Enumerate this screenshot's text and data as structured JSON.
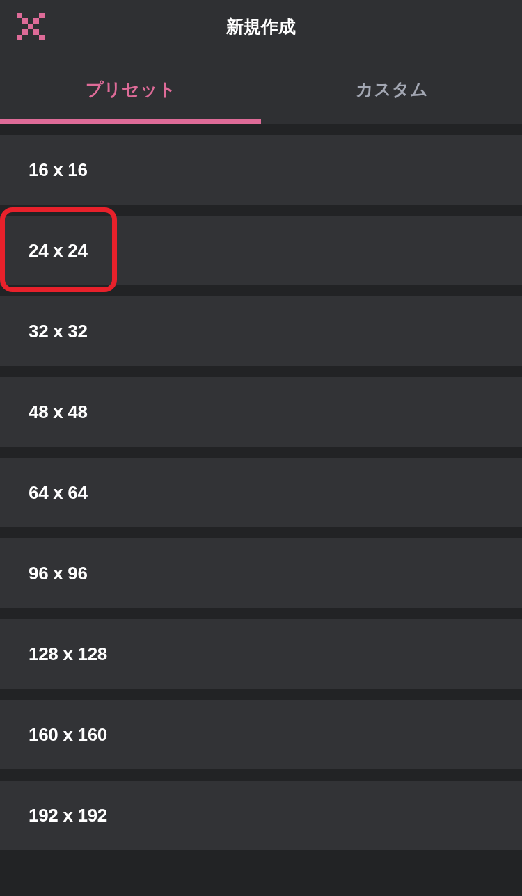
{
  "header": {
    "title": "新規作成"
  },
  "tabs": [
    {
      "label": "プリセット",
      "selected": true
    },
    {
      "label": "カスタム",
      "selected": false
    }
  ],
  "presets": [
    {
      "label": "16 x 16",
      "highlighted": false
    },
    {
      "label": "24 x 24",
      "highlighted": true
    },
    {
      "label": "32 x 32",
      "highlighted": false
    },
    {
      "label": "48 x 48",
      "highlighted": false
    },
    {
      "label": "64 x 64",
      "highlighted": false
    },
    {
      "label": "96 x 96",
      "highlighted": false
    },
    {
      "label": "128 x 128",
      "highlighted": false
    },
    {
      "label": "160 x 160",
      "highlighted": false
    },
    {
      "label": "192 x 192",
      "highlighted": false
    }
  ]
}
